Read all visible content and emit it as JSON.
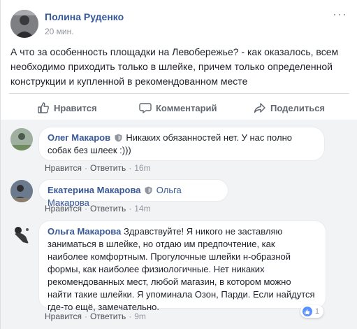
{
  "post": {
    "author": "Полина Руденко",
    "time": "20 мин.",
    "more_label": "···",
    "text": "А что за особенность площадки на Левобережье? - как оказалось, всем необходимо приходить только в шлейке, причем только определенной конструкции и купленной в рекомендованном месте"
  },
  "actions": {
    "like": "Нравится",
    "comment": "Комментарий",
    "share": "Поделиться"
  },
  "comments": [
    {
      "author": "Олег Макаров",
      "text": "Никаких обязанностей нет. У нас полно собак без шлеек :)))",
      "like_label": "Нравится",
      "reply_label": "Ответить",
      "time": "16m"
    },
    {
      "author": "Екатерина Макарова",
      "mention": "Ольга Макарова",
      "like_label": "Нравится",
      "reply_label": "Ответить",
      "time": "14m"
    },
    {
      "author": "Ольга Макарова",
      "text": "Здравствуйте! Я никого не заставляю заниматься в шлейке, но отдаю им предпочтение, как наиболее комфортным. Прогулочные шлейки н-образной формы, как наиболее физиологичные. Нет никаких рекомендованных мест, любой магазин, в котором можно найти такие шлейки. Я упоминала Озон, Парди. Если найдутся где-то ещё, замечательно.",
      "like_label": "Нравится",
      "reply_label": "Ответить",
      "time": "9m",
      "reactions": "1"
    }
  ],
  "colors": {
    "link_blue": "#365899",
    "muted": "#90949c",
    "like_blue": "#5890ff"
  },
  "icons": [
    "thumbs-up-icon",
    "comment-icon",
    "share-icon",
    "shield-icon",
    "more-icon"
  ]
}
